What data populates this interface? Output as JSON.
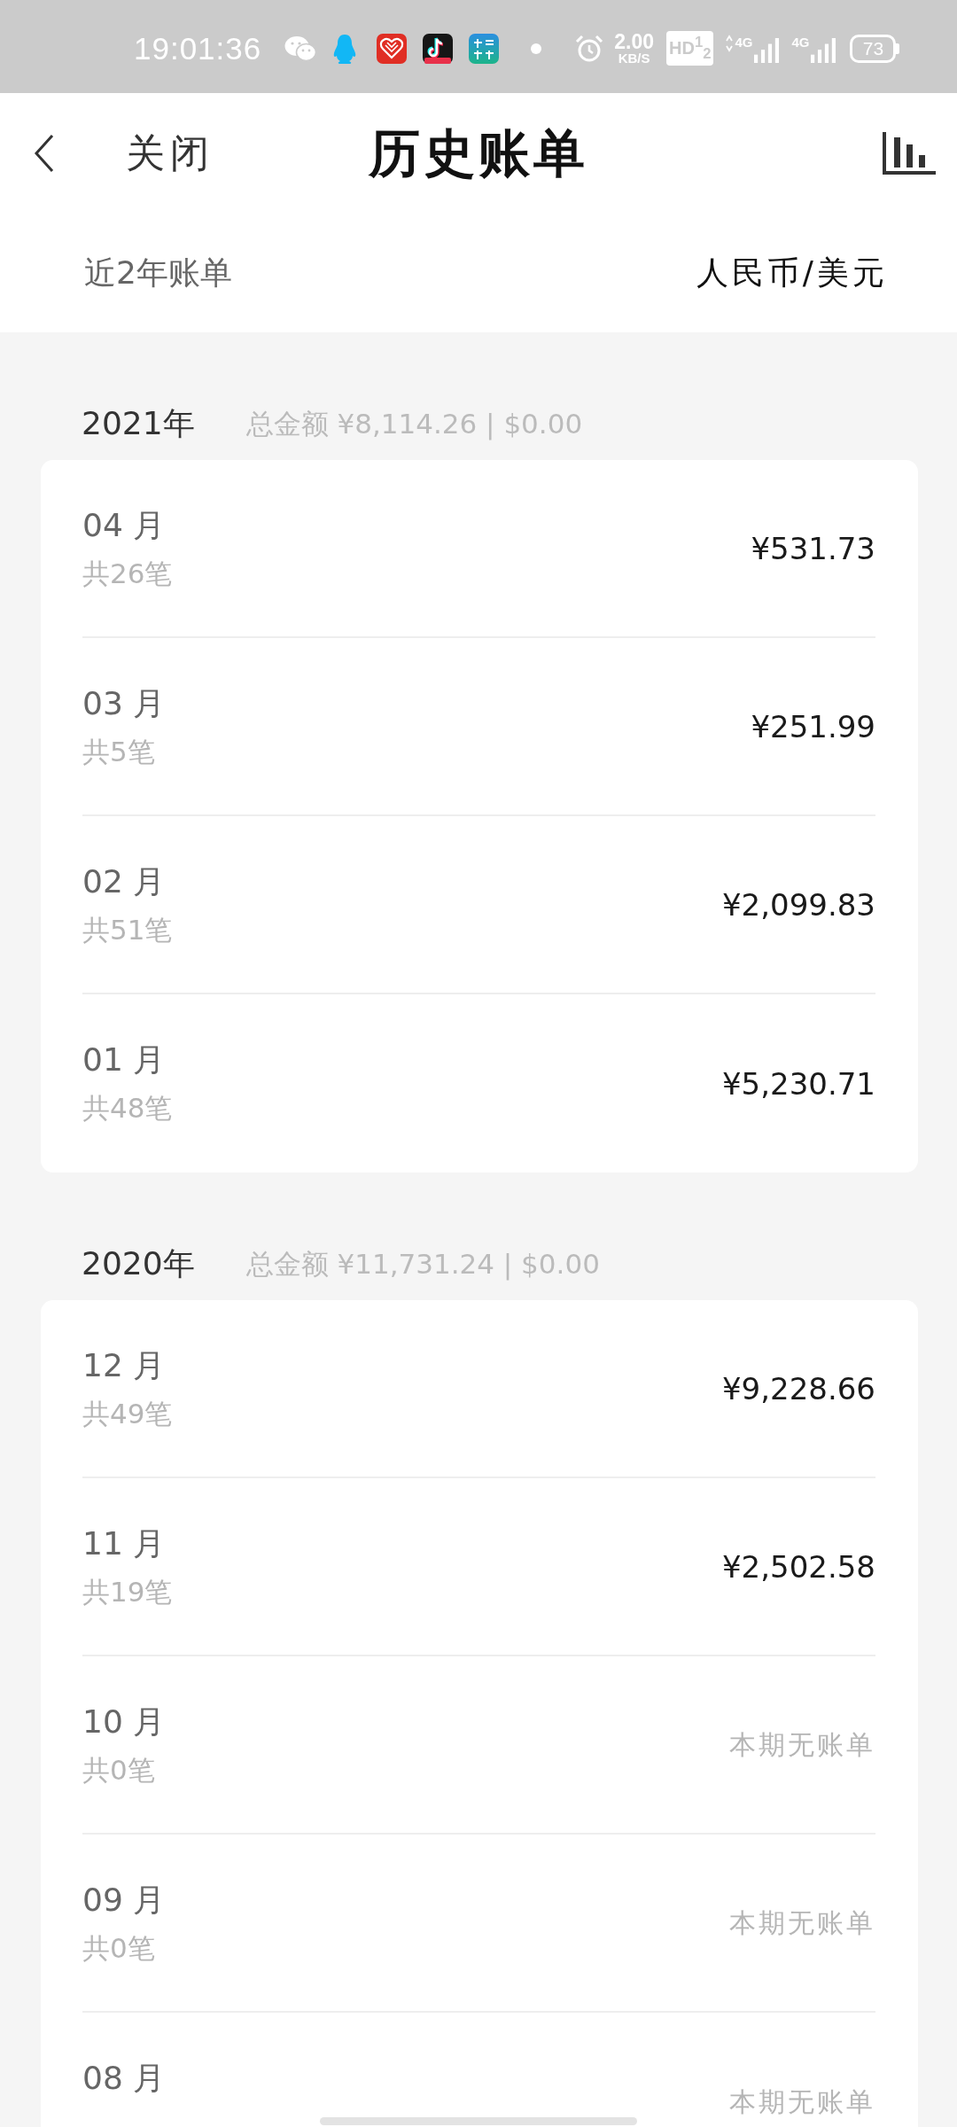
{
  "status_bar": {
    "time": "19:01:36",
    "net_speed": "2.00",
    "net_unit": "KB/S",
    "hd_badge": "HD$^{1}$$_{2}$",
    "signals": [
      {
        "label": "4G",
        "data_arrows": true
      },
      {
        "label": "4G",
        "data_arrows": false
      }
    ],
    "battery": "73"
  },
  "header": {
    "close": "关闭",
    "title": "历史账单"
  },
  "filter": {
    "range": "近2年账单",
    "currency": "人民币/美元"
  },
  "years": [
    {
      "year": "2021年",
      "total": "总金额 ¥8,114.26 | $0.00",
      "months": [
        {
          "month": "04 月",
          "count": "共26笔",
          "kind": "amount",
          "value": "¥531.73"
        },
        {
          "month": "03 月",
          "count": "共5笔",
          "kind": "amount",
          "value": "¥251.99"
        },
        {
          "month": "02 月",
          "count": "共51笔",
          "kind": "amount",
          "value": "¥2,099.83"
        },
        {
          "month": "01 月",
          "count": "共48笔",
          "kind": "amount",
          "value": "¥5,230.71"
        }
      ]
    },
    {
      "year": "2020年",
      "total": "总金额 ¥11,731.24 | $0.00",
      "months": [
        {
          "month": "12 月",
          "count": "共49笔",
          "kind": "amount",
          "value": "¥9,228.66"
        },
        {
          "month": "11 月",
          "count": "共19笔",
          "kind": "amount",
          "value": "¥2,502.58"
        },
        {
          "month": "10 月",
          "count": "共0笔",
          "kind": "none",
          "value": "本期无账单"
        },
        {
          "month": "09 月",
          "count": "共0笔",
          "kind": "none",
          "value": "本期无账单"
        },
        {
          "month": "08 月",
          "kind": "none",
          "value": "本期无账单"
        }
      ]
    }
  ]
}
